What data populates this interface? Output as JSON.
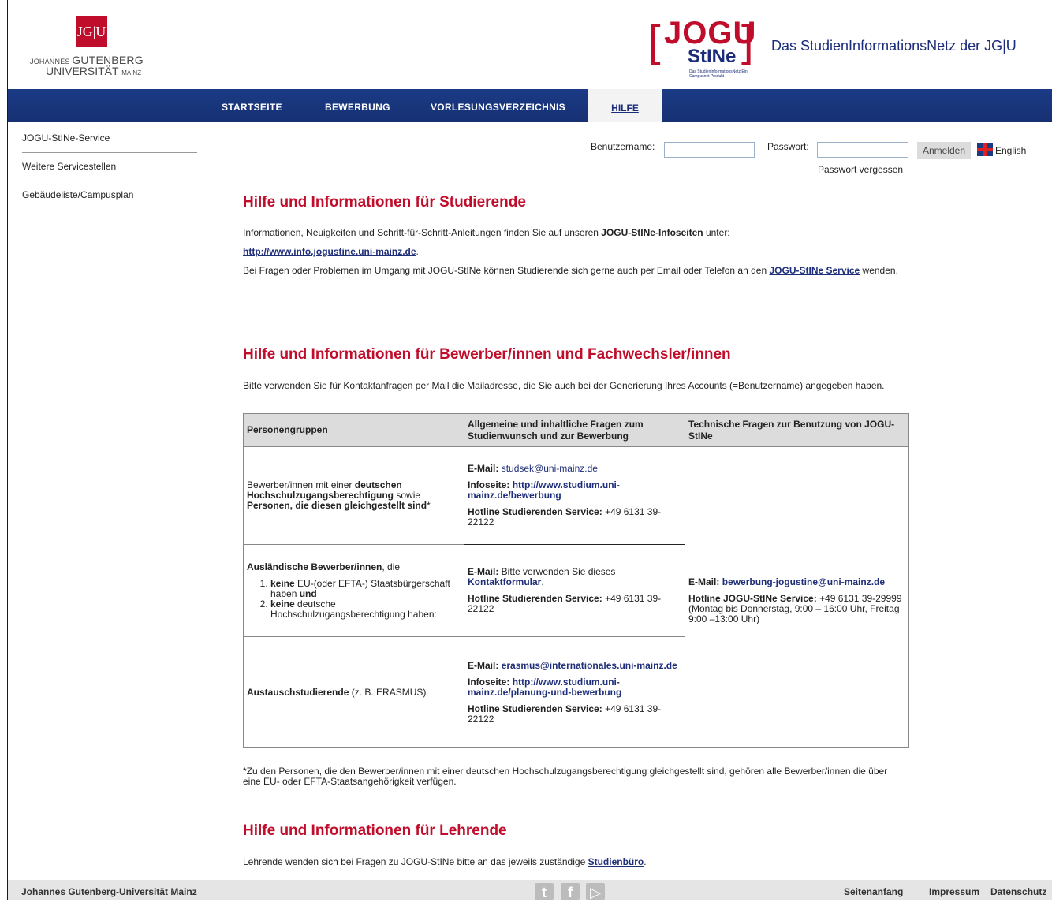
{
  "header": {
    "jgu_logo": {
      "box": "JG|U",
      "line1_small": "JOHANNES",
      "line1_big": "GUTENBERG",
      "line2": "UNIVERSITÄT",
      "line2_small": "MAINZ"
    },
    "stine_logo": {
      "jogu": "JOGU",
      "stine": "StINe",
      "small": "Das StudienInformationsNetz Ein Campusnet Produkt"
    },
    "site_title": "Das StudienInformationsNetz der JG|U"
  },
  "nav": {
    "items": [
      "STARTSEITE",
      "BEWERBUNG",
      "VORLESUNGSVERZEICHNIS"
    ],
    "active": "HILFE"
  },
  "sidebar": {
    "items": [
      "JOGU-StINe-Service",
      "Weitere Servicestellen",
      "Gebäudeliste/Campusplan"
    ]
  },
  "login": {
    "username_label": "Benutzername:",
    "username_value": "",
    "password_label": "Passwort:",
    "password_value": "",
    "submit": "Anmelden",
    "language": "English",
    "forgot": "Passwort vergessen"
  },
  "section1": {
    "title": "Hilfe und Informationen für Studierende",
    "p1_a": "Informationen, Neuigkeiten und Schritt-für-Schritt-Anleitungen finden Sie auf unseren ",
    "p1_b": "JOGU-StINe-Infoseiten",
    "p1_c": " unter:",
    "link": "http://www.info.jogustine.uni-mainz.de",
    "p2_a": "Bei Fragen oder Problemen im Umgang mit JOGU-StINe können Studierende sich gerne auch per Email oder Telefon an den ",
    "p2_link": "JOGU-StINe Service",
    "p2_c": " wenden."
  },
  "section2": {
    "title": "Hilfe und Informationen für Bewerber/innen und Fachwechsler/innen",
    "intro": "Bitte verwenden Sie für Kontaktanfragen per Mail die Mailadresse, die Sie auch bei der Generierung Ihres Accounts (=Benutzername) angegeben haben.",
    "table": {
      "headers": [
        "Personengruppen",
        "Allgemeine und inhaltliche Fragen zum Studienwunsch und zur Bewerbung",
        "Technische Fragen zur Benutzung von JOGU-StINe"
      ],
      "row1": {
        "c1_a": "Bewerber/innen mit einer ",
        "c1_b": "deutschen Hochschulzugangsberechtigung",
        "c1_c": " sowie ",
        "c1_d": "Personen, die diesen gleichgestellt sind",
        "c1_e": "*",
        "email_label": "E-Mail:",
        "email": "studsek@uni-mainz.de",
        "info_label": "Infoseite:",
        "info": "http://www.studium.uni-mainz.de/bewerbung",
        "hotline_label": "Hotline Studierenden Service:",
        "hotline": "+49 6131 39-22122"
      },
      "row2": {
        "c1_a": "Ausländische Bewerber/innen",
        "c1_b": ", die",
        "li1_a": "keine",
        "li1_b": " EU-(oder EFTA-) Staatsbürgerschaft haben ",
        "li1_c": "und",
        "li2_a": "keine",
        "li2_b": " deutsche Hochschulzugangsberechtigung haben:",
        "email_label": "E-Mail:",
        "email_text": " Bitte verwenden Sie dieses ",
        "email_link": "Kontaktformular",
        "hotline_label": "Hotline Studierenden Service:",
        "hotline": "+49 6131 39-22122"
      },
      "row3": {
        "c1_a": "Austauschstudierende",
        "c1_b": " (z. B. ERASMUS)",
        "email_label": "E-Mail:",
        "email": "erasmus@internationales.uni-mainz.de",
        "info_label": "Infoseite:",
        "info": "http://www.studium.uni-mainz.de/planung-und-bewerbung",
        "hotline_label": "Hotline Studierenden Service:",
        "hotline": "+49 6131 39-22122"
      },
      "tech": {
        "email_label": "E-Mail:",
        "email": "bewerbung-jogustine@uni-mainz.de",
        "hotline_label": "Hotline JOGU-StINe Service:",
        "hotline": "+49 6131 39-29999",
        "hours": "(Montag bis Donnerstag, 9:00 – 16:00 Uhr, Freitag 9:00 –13:00 Uhr)"
      }
    },
    "footnote": "*Zu den Personen, die den Bewerber/innen mit einer deutschen Hochschulzugangsberechtigung gleichgestellt sind, gehören alle Bewerber/innen die über eine EU- oder EFTA-Staatsangehörigkeit verfügen."
  },
  "section3": {
    "title": "Hilfe und Informationen für Lehrende",
    "p_a": "Lehrende wenden sich bei Fragen zu JOGU-StINe bitte an das jeweils zuständige ",
    "p_link": "Studienbüro",
    "p_c": "."
  },
  "footer": {
    "left": "Johannes Gutenberg-Universität Mainz",
    "social_icons": [
      "twitter-icon",
      "facebook-icon",
      "youtube-icon"
    ],
    "links": [
      "Seitenanfang",
      "Impressum",
      "Datenschutz"
    ]
  }
}
